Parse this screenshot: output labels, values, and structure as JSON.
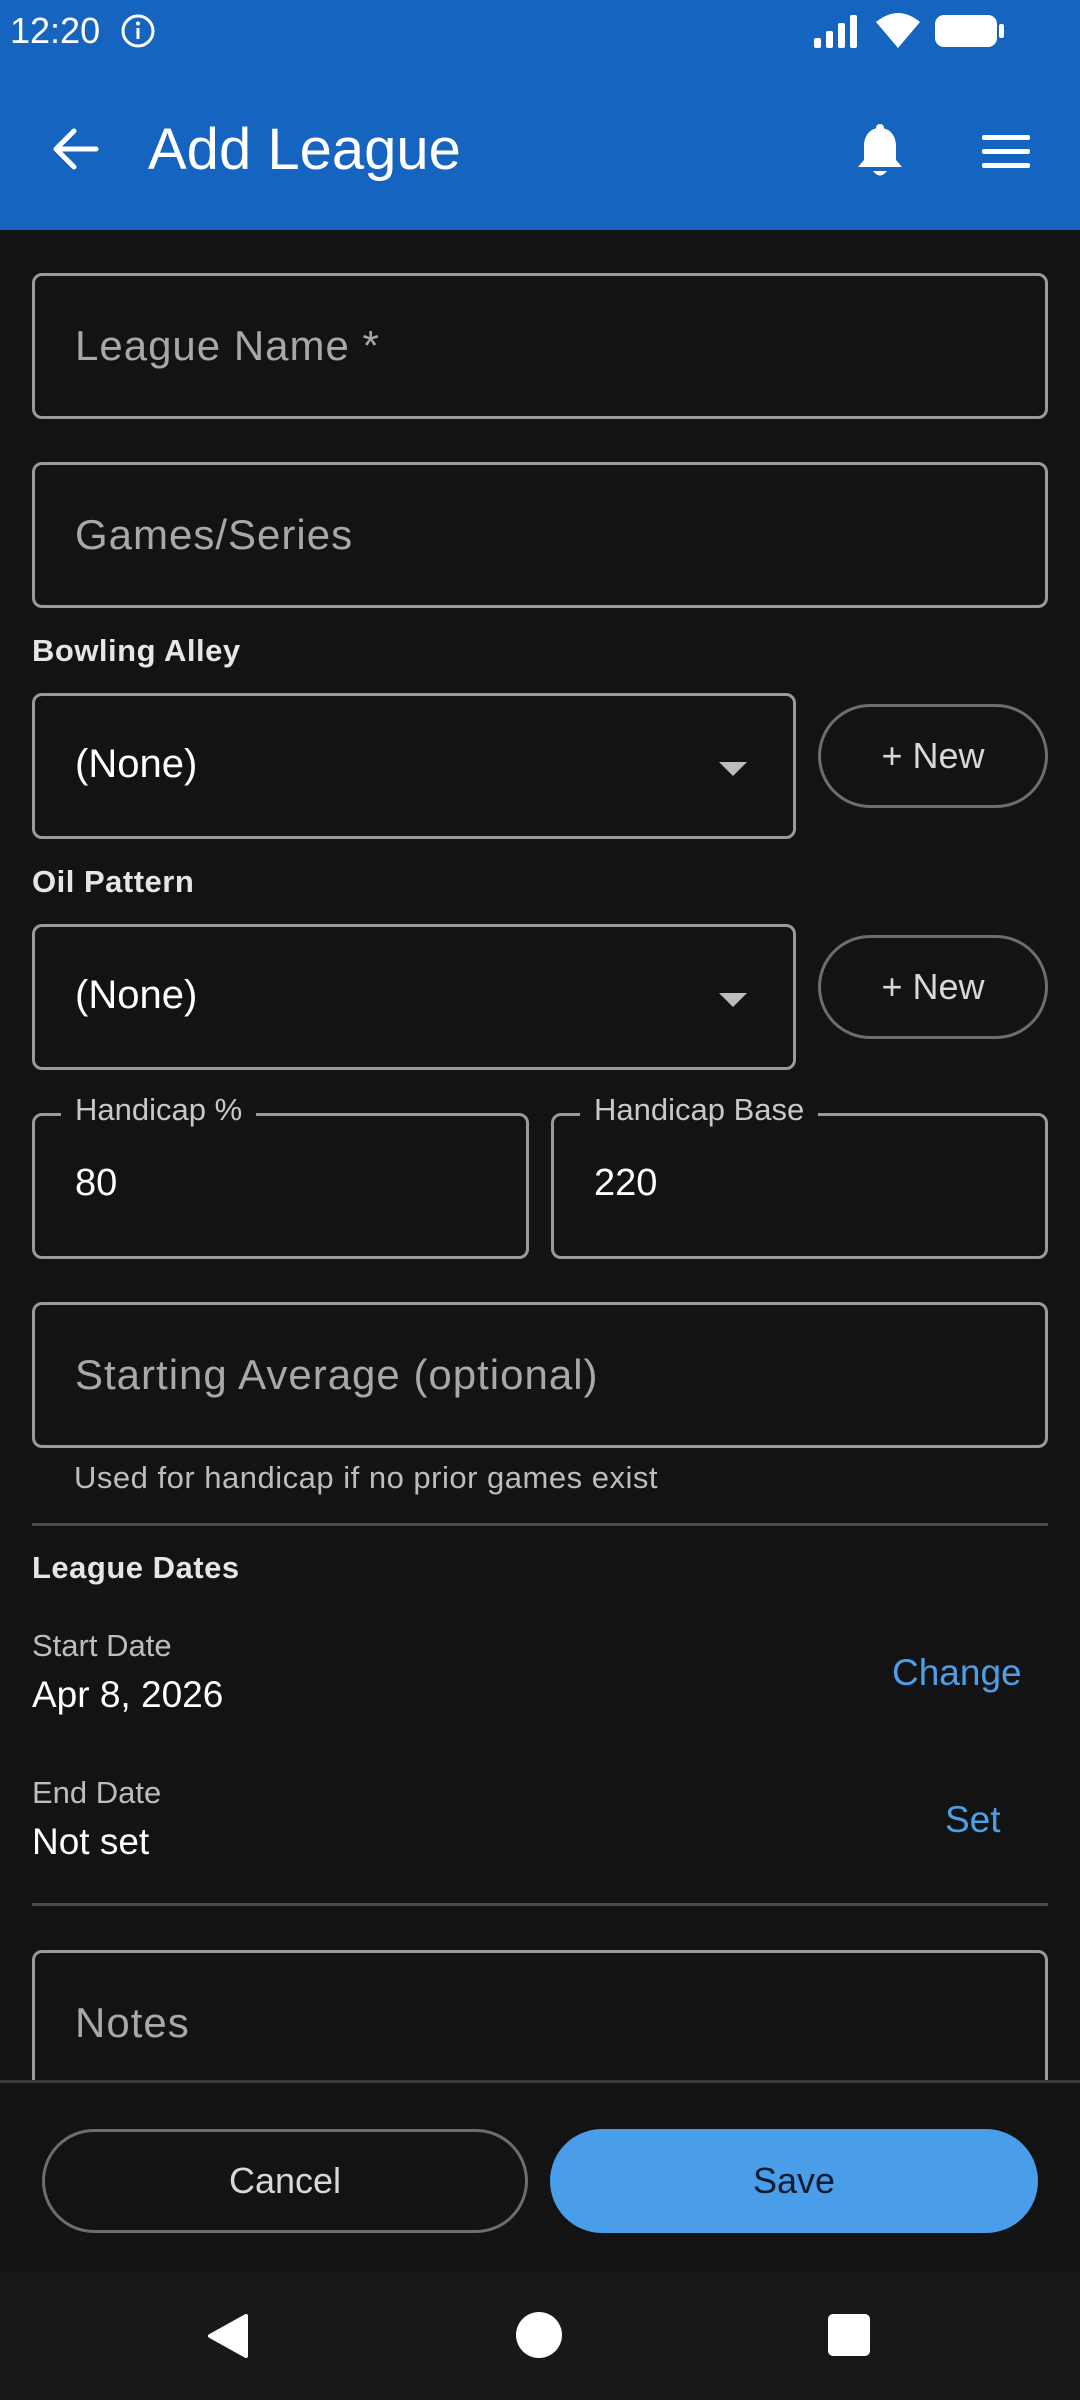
{
  "status_bar": {
    "time": "12:20",
    "icons": [
      "info-icon",
      "signal-icon",
      "wifi-icon",
      "battery-icon"
    ]
  },
  "app_bar": {
    "title": "Add League",
    "icons": [
      "back-arrow-icon",
      "bell-icon",
      "hamburger-menu-icon"
    ],
    "color": "#1565c0"
  },
  "form": {
    "league_name_placeholder": "League Name *",
    "games_series_placeholder": "Games/Series",
    "bowling_alley": {
      "label": "Bowling Alley",
      "selected": "(None)",
      "new_label": "+ New"
    },
    "oil_pattern": {
      "label": "Oil Pattern",
      "selected": "(None)",
      "new_label": "+ New"
    },
    "handicap_percent": {
      "label": "Handicap %",
      "value": "80"
    },
    "handicap_base": {
      "label": "Handicap Base",
      "value": "220"
    },
    "starting_average": {
      "placeholder": "Starting Average (optional)",
      "helper": "Used for handicap if no prior games exist"
    },
    "league_dates": {
      "heading": "League Dates",
      "start": {
        "label": "Start Date",
        "value": "Apr 8, 2026",
        "action": "Change"
      },
      "end": {
        "label": "End Date",
        "value": "Not set",
        "action": "Set"
      }
    },
    "notes_placeholder": "Notes"
  },
  "actions": {
    "cancel_label": "Cancel",
    "save_label": "Save",
    "save_color": "#4a9de9"
  },
  "nav_bar": {
    "icons": [
      "nav-back-icon",
      "nav-home-icon",
      "nav-recents-icon"
    ]
  }
}
